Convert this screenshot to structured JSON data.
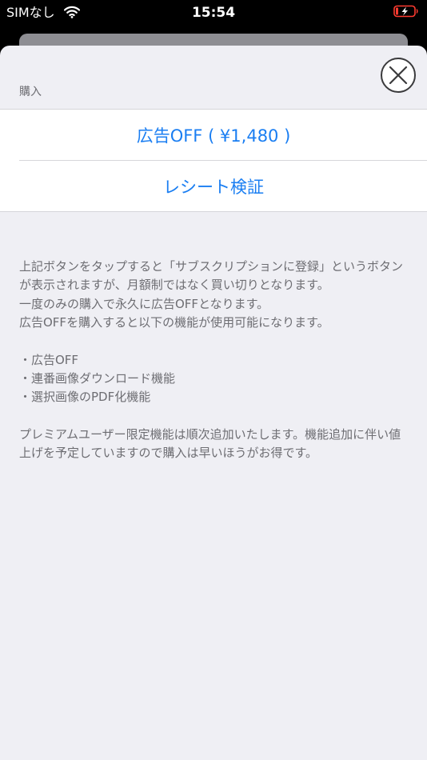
{
  "status_bar": {
    "carrier": "SIMなし",
    "time": "15:54"
  },
  "sheet": {
    "section_header": "購入",
    "buttons": {
      "ad_off": "広告OFF ( ¥1,480 )",
      "verify_receipt": "レシート検証"
    },
    "description": {
      "para1": "上記ボタンをタップすると「サブスクリプションに登録」というボタンが表示されますが、月額制ではなく買い切りとなります。",
      "para2": "一度のみの購入で永久に広告OFFとなります。",
      "para3": "広告OFFを購入すると以下の機能が使用可能になります。",
      "features": [
        "・広告OFF",
        "・連番画像ダウンロード機能",
        "・選択画像のPDF化機能"
      ],
      "para4": "プレミアムユーザー限定機能は順次追加いたします。機能追加に伴い値上げを予定していますので購入は早いほうがお得です。"
    }
  },
  "colors": {
    "accent": "#1a7ef2",
    "secondary_text": "#6d6d72",
    "sheet_background": "#efeff4",
    "battery_low": "#ff3b30"
  }
}
